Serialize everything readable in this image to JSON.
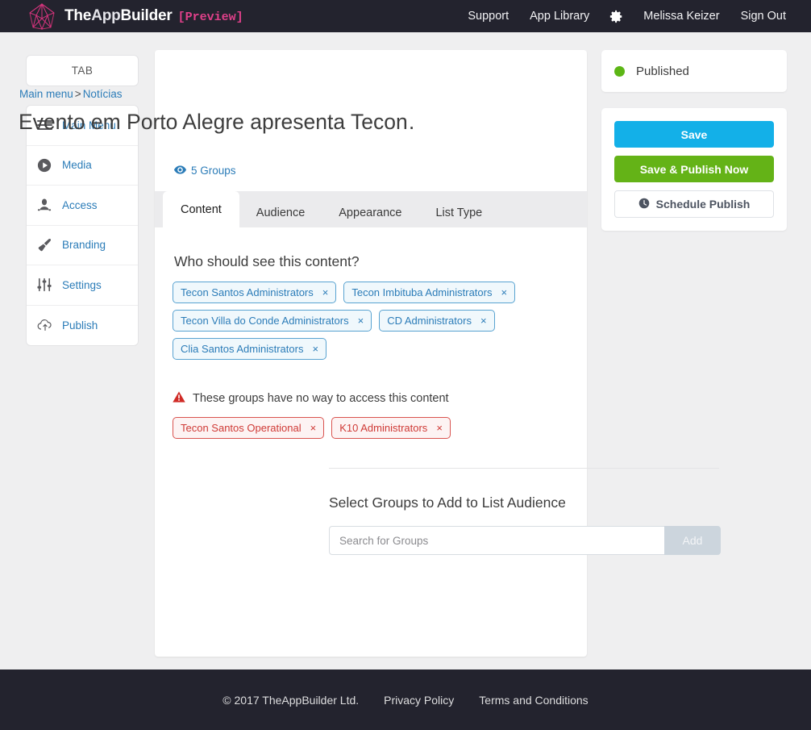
{
  "navbar": {
    "brand_the": "The",
    "brand_app": "App",
    "brand_builder": "Builder",
    "preview_tag": "[Preview]",
    "links": [
      {
        "label": "Support"
      },
      {
        "label": "App Library"
      }
    ],
    "gear_icon": "gear-icon",
    "user_name": "Melissa Keizer",
    "sign_out": "Sign Out"
  },
  "sidebar": {
    "tab_label": "TAB",
    "items": [
      {
        "label": "Main Menu",
        "icon": "hamburger-menu-icon"
      },
      {
        "label": "Media",
        "icon": "play-circle-icon"
      },
      {
        "label": "Access",
        "icon": "user-access-icon"
      },
      {
        "label": "Branding",
        "icon": "paintbrush-icon"
      },
      {
        "label": "Settings",
        "icon": "sliders-icon"
      },
      {
        "label": "Publish",
        "icon": "cloud-upload-icon"
      }
    ]
  },
  "main": {
    "breadcrumb_root": "Main menu",
    "breadcrumb_sep": ">",
    "breadcrumb_current": "Notícias",
    "title": "Evento em Porto Alegre apresenta Tecon…",
    "groups_count_label": "5 Groups",
    "groups_count_icon": "eye-icon",
    "tabs": [
      {
        "label": "Content",
        "active": true
      },
      {
        "label": "Audience",
        "active": false
      },
      {
        "label": "Appearance",
        "active": false
      },
      {
        "label": "List Type",
        "active": false
      }
    ],
    "audience_question": "Who should see this content?",
    "allowed_groups": [
      {
        "label": "Tecon Santos Administrators"
      },
      {
        "label": "Tecon Imbituba Administrators"
      },
      {
        "label": "Tecon Villa do Conde Administrators"
      },
      {
        "label": "CD Administrators"
      },
      {
        "label": "Clia Santos Administrators"
      }
    ],
    "warning_icon": "warning-triangle-icon",
    "warning_text": "These groups have no way to access this content",
    "blocked_groups": [
      {
        "label": "Tecon Santos Operational"
      },
      {
        "label": "K10 Administrators"
      }
    ],
    "select_groups_title": "Select Groups to Add to List Audience",
    "search_placeholder": "Search for Groups",
    "search_value": "",
    "add_button_label": "Add",
    "remove_glyph": "×"
  },
  "right": {
    "status_label": "Published",
    "status_color": "#5cb615",
    "save_label": "Save",
    "save_publish_label": "Save & Publish Now",
    "schedule_label": "Schedule Publish",
    "schedule_icon": "clock-icon"
  },
  "footer": {
    "copyright": "© 2017 TheAppBuilder Ltd.",
    "links": [
      {
        "label": "Privacy Policy"
      },
      {
        "label": "Terms and Conditions"
      }
    ]
  },
  "colors": {
    "navbar_bg": "#23232e",
    "accent_pink": "#e0408a",
    "link_blue": "#2b7cb8",
    "save_blue": "#13b0e8",
    "publish_green": "#64b317",
    "danger_red": "#cf3a36"
  }
}
